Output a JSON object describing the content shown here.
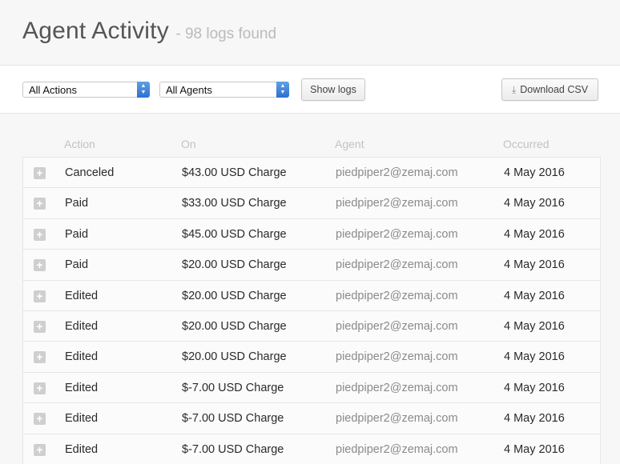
{
  "header": {
    "title": "Agent Activity",
    "count": "- 98 logs found"
  },
  "toolbar": {
    "action_filter": "All Actions",
    "agent_filter": "All Agents",
    "show_logs_label": "Show logs",
    "download_label": "Download CSV",
    "download_icon": "download-icon"
  },
  "table": {
    "columns": [
      "Action",
      "On",
      "Agent",
      "Occurred"
    ],
    "rows": [
      {
        "action": "Canceled",
        "on": "$43.00 USD Charge",
        "agent": "piedpiper2@zemaj.com",
        "occurred": "4 May 2016"
      },
      {
        "action": "Paid",
        "on": "$33.00 USD Charge",
        "agent": "piedpiper2@zemaj.com",
        "occurred": "4 May 2016"
      },
      {
        "action": "Paid",
        "on": "$45.00 USD Charge",
        "agent": "piedpiper2@zemaj.com",
        "occurred": "4 May 2016"
      },
      {
        "action": "Paid",
        "on": "$20.00 USD Charge",
        "agent": "piedpiper2@zemaj.com",
        "occurred": "4 May 2016"
      },
      {
        "action": "Edited",
        "on": "$20.00 USD Charge",
        "agent": "piedpiper2@zemaj.com",
        "occurred": "4 May 2016"
      },
      {
        "action": "Edited",
        "on": "$20.00 USD Charge",
        "agent": "piedpiper2@zemaj.com",
        "occurred": "4 May 2016"
      },
      {
        "action": "Edited",
        "on": "$20.00 USD Charge",
        "agent": "piedpiper2@zemaj.com",
        "occurred": "4 May 2016"
      },
      {
        "action": "Edited",
        "on": "$-7.00 USD Charge",
        "agent": "piedpiper2@zemaj.com",
        "occurred": "4 May 2016"
      },
      {
        "action": "Edited",
        "on": "$-7.00 USD Charge",
        "agent": "piedpiper2@zemaj.com",
        "occurred": "4 May 2016"
      },
      {
        "action": "Edited",
        "on": "$-7.00 USD Charge",
        "agent": "piedpiper2@zemaj.com",
        "occurred": "4 May 2016"
      }
    ]
  }
}
